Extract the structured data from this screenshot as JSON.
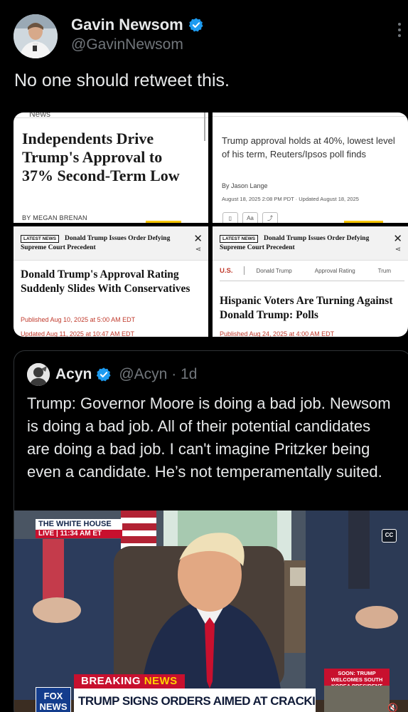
{
  "tweet": {
    "display_name": "Gavin Newsom",
    "handle": "@GavinNewsom",
    "text": "No one should retweet this.",
    "verified": true,
    "verified_color": "#1d9bf0",
    "more_icon": "more-vertical-icon"
  },
  "images": {
    "gallup": {
      "section": "News",
      "headline": "Independents Drive Trump's Approval to 37% Second-Term Low",
      "byline": "BY MEGAN BRENAN"
    },
    "reuters": {
      "headline": "Trump approval holds at 40%, lowest level of his term, Reuters/Ipsos poll finds",
      "author": "By Jason Lange",
      "date": "August 18, 2025 2:08 PM PDT · Updated August 18, 2025",
      "tool_aa": "Aa"
    },
    "ticker": {
      "badge": "LATEST NEWS",
      "text": "Donald Trump Issues Order Defying",
      "text2": "Supreme Court Precedent"
    },
    "newsweek_left": {
      "headline": "Donald Trump's Approval Rating Suddenly Slides With Conservatives",
      "published": "Published Aug 10, 2025 at 5:00 AM EDT",
      "updated": "Updated Aug 11, 2025 at 10:47 AM EDT"
    },
    "newsweek_right": {
      "tag_us": "U.S.",
      "tag_1": "Donald Trump",
      "tag_2": "Approval Rating",
      "tag_3": "Trum",
      "headline": "Hispanic Voters Are Turning Against Donald Trump: Polls",
      "published": "Published Aug 24, 2025 at 4:00 AM EDT"
    }
  },
  "quote": {
    "display_name": "Acyn",
    "handle": "@Acyn · 1d",
    "text": "Trump: Governor Moore is doing a bad job. Newsom is doing a bad job. All of their potential candidates are doing a bad job. I can't imagine Pritzker being even a candidate. He’s not temperamentally suited.",
    "video": {
      "bug_title": "THE WHITE HOUSE",
      "bug_live": "LIVE | 11:34 AM ET",
      "cc": "CC",
      "breaking_prefix": "BREAKING",
      "breaking_suffix": "NEWS",
      "lower_third": "TRUMP SIGNS ORDERS AIMED AT CRACKING DOWN ON CRIME",
      "network": "FOX NEWS",
      "soon": "SOON: TRUMP WELCOMES SOUTH KOREA PRESIDENT",
      "mute_icon": "muted-speaker-icon"
    }
  }
}
